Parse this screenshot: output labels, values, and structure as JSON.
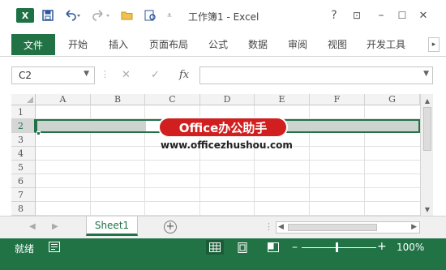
{
  "titlebar": {
    "app_logo": "X",
    "title": "工作簿1 - Excel",
    "help": "?",
    "restore_ribbon": "⊡",
    "minimize": "–",
    "maximize": "☐",
    "close": "✕"
  },
  "quick_access": {
    "save_icon": "save-icon",
    "undo_icon": "undo-icon",
    "redo_icon": "redo-icon",
    "open_icon": "folder-open-icon",
    "preview_icon": "print-preview-icon",
    "customize_icon": "customize-icon"
  },
  "ribbon": {
    "tabs": [
      "文件",
      "开始",
      "插入",
      "页面布局",
      "公式",
      "数据",
      "审阅",
      "视图",
      "开发工具"
    ],
    "collapse": "▸"
  },
  "formula_bar": {
    "name_box": "C2",
    "cancel": "✕",
    "enter": "✓",
    "fx": "fx",
    "formula": ""
  },
  "grid": {
    "columns": [
      "A",
      "B",
      "C",
      "D",
      "E",
      "F",
      "G"
    ],
    "rows": [
      "1",
      "2",
      "3",
      "4",
      "5",
      "6",
      "7",
      "8"
    ],
    "selected_row": "2",
    "active_cell": "C2"
  },
  "watermark": {
    "badge": "Office办公助手",
    "url": "www.officezhushou.com"
  },
  "sheet_tabs": {
    "tabs": [
      "Sheet1"
    ],
    "add": "+"
  },
  "status_bar": {
    "ready": "就绪",
    "zoom": "100%",
    "zoom_fraction": 0.5
  },
  "colors": {
    "accent": "#217346",
    "badge": "#d11f1f"
  }
}
